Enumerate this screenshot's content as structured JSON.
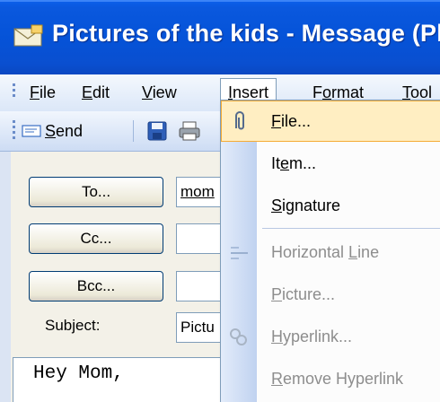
{
  "window": {
    "title": "Pictures of the kids - Message (Plai"
  },
  "menu_bar": {
    "items": [
      {
        "label": "File",
        "mnemonic_index": 0
      },
      {
        "label": "Edit",
        "mnemonic_index": 0
      },
      {
        "label": "View",
        "mnemonic_index": 0
      },
      {
        "label": "Insert",
        "mnemonic_index": 0
      },
      {
        "label": "Format",
        "mnemonic_index": 1
      },
      {
        "label": "Tool",
        "mnemonic_index": 0
      }
    ],
    "active": "Insert"
  },
  "toolbar": {
    "send_label": "Send"
  },
  "compose": {
    "to_button": "To...",
    "cc_button": "Cc...",
    "bcc_button": "Bcc...",
    "to_value": "mom",
    "cc_value": "",
    "bcc_value": "",
    "subject_label": "Subject:",
    "subject_value": "Pictu",
    "body_text": "Hey Mom,"
  },
  "insert_menu": {
    "items": [
      {
        "label": "File...",
        "icon": "paperclip-icon",
        "enabled": true,
        "highlighted": true
      },
      {
        "label": "Item...",
        "icon": "",
        "enabled": true,
        "highlighted": false
      },
      {
        "label": "Signature",
        "icon": "",
        "enabled": true,
        "highlighted": false
      },
      {
        "label": "Horizontal Line",
        "icon": "horizontal-line-icon",
        "enabled": false,
        "highlighted": false
      },
      {
        "label": "Picture...",
        "icon": "",
        "enabled": false,
        "highlighted": false
      },
      {
        "label": "Hyperlink...",
        "icon": "hyperlink-icon",
        "enabled": false,
        "highlighted": false
      },
      {
        "label": "Remove Hyperlink",
        "icon": "",
        "enabled": false,
        "highlighted": false
      }
    ]
  },
  "colors": {
    "title_bar": "#0553d8",
    "menu_highlight": "#ffeec2",
    "menu_highlight_border": "#f5ab35",
    "disabled_text": "#8d8d8d"
  }
}
